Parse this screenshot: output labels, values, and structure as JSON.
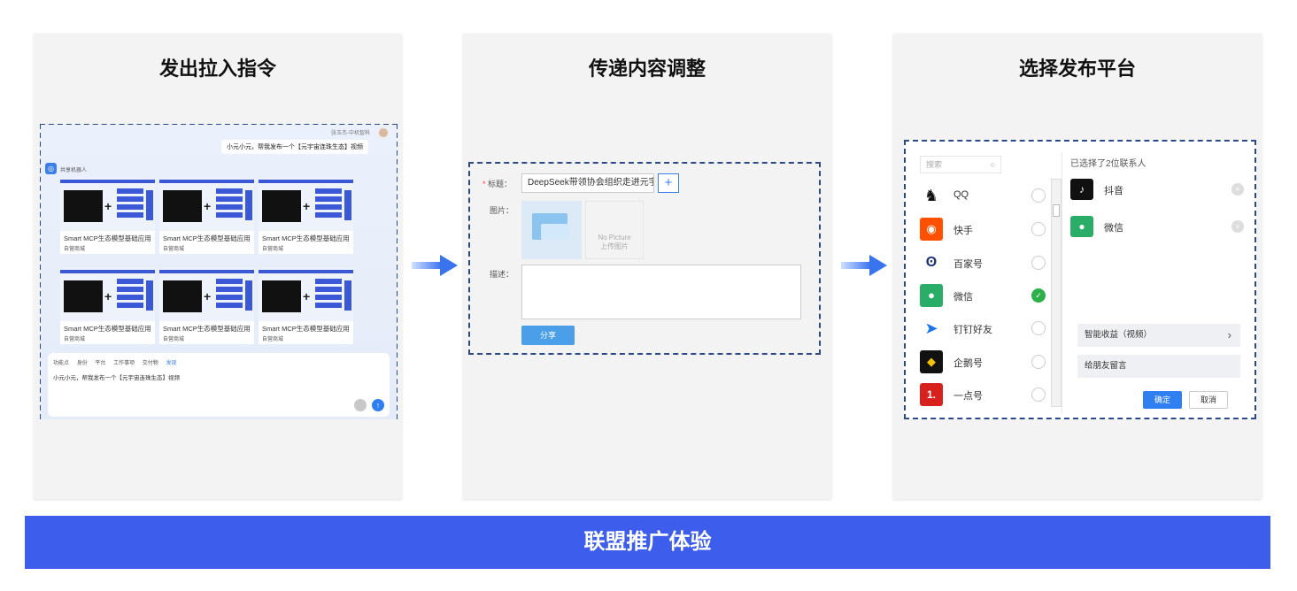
{
  "steps": [
    {
      "title": "发出拉入指令"
    },
    {
      "title": "传递内容调整"
    },
    {
      "title": "选择发布平台"
    }
  ],
  "banner": {
    "text": "联盟推广体验"
  },
  "step1": {
    "user_line": "张玉杰-中机智科",
    "user_bubble": "小元小元，帮我发布一个【元宇宙连珠生态】视频",
    "bot_name": "共享机器人",
    "cards": [
      {
        "title": "Smart MCP生态模型基础应用",
        "meta": "自营商城"
      },
      {
        "title": "Smart MCP生态模型基础应用",
        "meta": "自营商城"
      },
      {
        "title": "Smart MCP生态模型基础应用",
        "meta": "自营商城"
      },
      {
        "title": "Smart MCP生态模型基础应用",
        "meta": "自营商城"
      },
      {
        "title": "Smart MCP生态模型基础应用",
        "meta": "自营商城"
      },
      {
        "title": "Smart MCP生态模型基础应用",
        "meta": "自营商城"
      }
    ],
    "chips": [
      "功能点",
      "身份",
      "平台",
      "工作事项",
      "交付物",
      "发现"
    ],
    "input_text": "小元小元，帮我发布一个【元宇宙连珠生态】视频"
  },
  "step2": {
    "title_label": "标题：",
    "title_value": "DeepSeek带领协会组织走进元宇i",
    "image_label": "图片：",
    "no_picture": "No Picture",
    "upload_label": "上传图片",
    "desc_label": "描述：",
    "share_label": "分享"
  },
  "step3": {
    "search_placeholder": "搜索",
    "platforms": [
      {
        "name": "QQ",
        "icon": "qq-icon",
        "checked": false
      },
      {
        "name": "快手",
        "icon": "kuaishou-icon",
        "checked": false
      },
      {
        "name": "百家号",
        "icon": "baijiahao-icon",
        "checked": false
      },
      {
        "name": "微信",
        "icon": "wechat-icon",
        "checked": true
      },
      {
        "name": "钉钉好友",
        "icon": "dingtalk-icon",
        "checked": false
      },
      {
        "name": "企鹅号",
        "icon": "qiehao-icon",
        "checked": false
      },
      {
        "name": "一点号",
        "icon": "yidianhao-icon",
        "checked": false
      }
    ],
    "selected_header": "已选择了2位联系人",
    "selected": [
      {
        "name": "抖音",
        "icon": "douyin-icon"
      },
      {
        "name": "微信",
        "icon": "wechat-icon"
      }
    ],
    "option_earnings": "智能收益（视频）",
    "option_message": "给朋友留言",
    "confirm_label": "确定",
    "cancel_label": "取消"
  }
}
